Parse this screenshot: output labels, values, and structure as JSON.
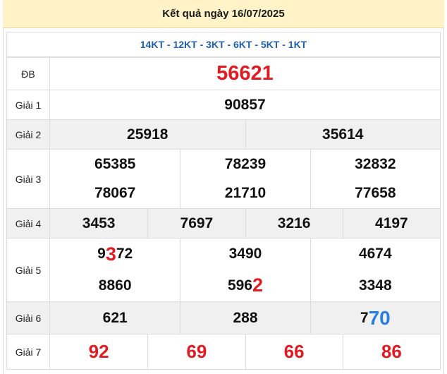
{
  "header": {
    "title": "Kết quả ngày 16/07/2025"
  },
  "codes": "14KT - 12KT - 3KT - 6KT - 5KT - 1KT",
  "prizes": {
    "db": {
      "label": "ĐB",
      "value": "56621"
    },
    "g1": {
      "label": "Giải 1",
      "value": "90857"
    },
    "g2": {
      "label": "Giải 2",
      "values": [
        "25918",
        "35614"
      ]
    },
    "g3": {
      "label": "Giải 3",
      "values": [
        "65385",
        "78239",
        "32832",
        "78067",
        "21710",
        "77658"
      ]
    },
    "g4": {
      "label": "Giải 4",
      "values": [
        "3453",
        "7697",
        "3216",
        "4197"
      ]
    },
    "g5": {
      "label": "Giải 5",
      "values": [
        {
          "pre": "9",
          "hl": "3",
          "post": "72"
        },
        {
          "pre": "3490",
          "hl": "",
          "post": ""
        },
        {
          "pre": "4674",
          "hl": "",
          "post": ""
        },
        {
          "pre": "8860",
          "hl": "",
          "post": ""
        },
        {
          "pre": "596",
          "hl": "2",
          "post": ""
        },
        {
          "pre": "3348",
          "hl": "",
          "post": ""
        }
      ]
    },
    "g6": {
      "label": "Giải 6",
      "values": [
        {
          "pre": "621",
          "hl": ""
        },
        {
          "pre": "288",
          "hl": ""
        },
        {
          "pre": "7",
          "hl": "70"
        }
      ]
    },
    "g7": {
      "label": "Giải 7",
      "values": [
        "92",
        "69",
        "66",
        "86"
      ]
    }
  },
  "colors": {
    "header_bg": "#fff3c7",
    "special_red": "#e11b22",
    "code_blue": "#1f5fae",
    "highlight_blue": "#2a7de1",
    "row_shade": "#f0f0f0"
  }
}
